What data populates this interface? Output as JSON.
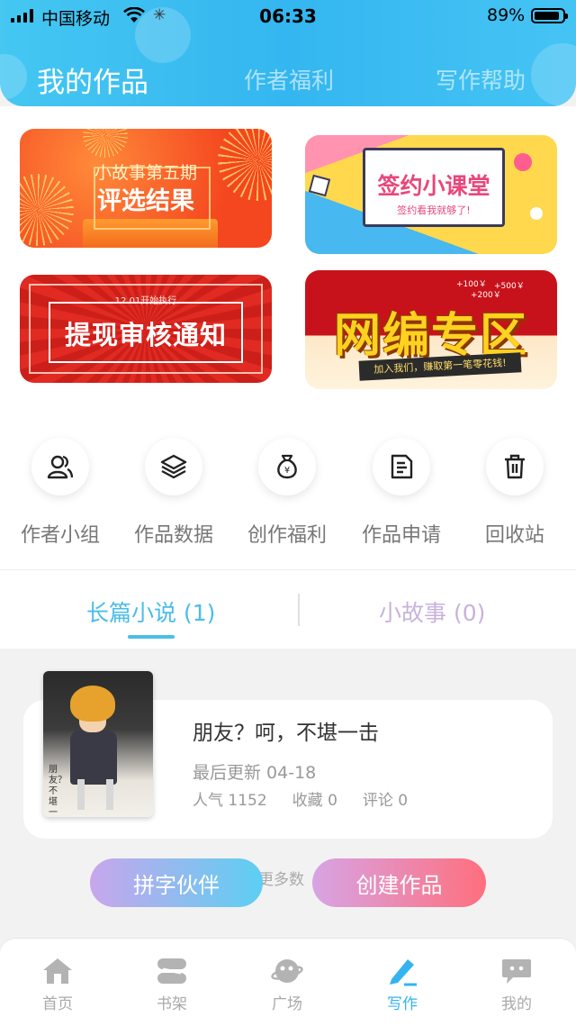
{
  "status_bar": {
    "carrier": "中国移动",
    "time": "06:33",
    "battery": "89%",
    "battery_level": 0.89
  },
  "header": {
    "tabs": [
      {
        "label": "我的作品",
        "active": true
      },
      {
        "label": "作者福利",
        "active": false
      },
      {
        "label": "写作帮助",
        "active": false
      }
    ]
  },
  "banners": [
    {
      "line1": "小故事第五期",
      "line2": "评选结果"
    },
    {
      "line1": "签约小课堂",
      "line2": "签约看我就够了!"
    },
    {
      "line1": "12.01开始执行",
      "line2": "提现审核通知"
    },
    {
      "line1": "网编专区",
      "line2": "加入我们，赚取第一笔零花钱!",
      "money": [
        "+100￥",
        "+500￥",
        "+200￥"
      ]
    }
  ],
  "shortcuts": [
    {
      "label": "作者小组",
      "icon": "users-icon"
    },
    {
      "label": "作品数据",
      "icon": "layers-icon"
    },
    {
      "label": "创作福利",
      "icon": "money-bag-icon"
    },
    {
      "label": "作品申请",
      "icon": "document-icon"
    },
    {
      "label": "回收站",
      "icon": "trash-icon"
    }
  ],
  "sub_tabs": [
    {
      "label": "长篇小说 (1)",
      "active": true
    },
    {
      "label": "小故事 (0)",
      "active": false
    }
  ],
  "work": {
    "title": "朋友？呵，不堪一击",
    "updated": "最后更新 04-18",
    "popularity": "人气 1152",
    "favorites": "收藏 0",
    "comments": "评论 0",
    "cover_text": "朋友？不堪一击"
  },
  "more_hint": "无更多数",
  "buttons": {
    "partner": "拼字伙伴",
    "create": "创建作品"
  },
  "bottom_nav": [
    {
      "label": "首页",
      "icon": "home-icon",
      "active": false
    },
    {
      "label": "书架",
      "icon": "bookshelf-icon",
      "active": false
    },
    {
      "label": "广场",
      "icon": "planet-icon",
      "active": false
    },
    {
      "label": "写作",
      "icon": "pen-icon",
      "active": true
    },
    {
      "label": "我的",
      "icon": "chat-bubble-icon",
      "active": false
    }
  ],
  "colors": {
    "header_blue": "#34b6f0",
    "accent_blue": "#4bbde8",
    "create_pink": "#ff6f7e"
  }
}
